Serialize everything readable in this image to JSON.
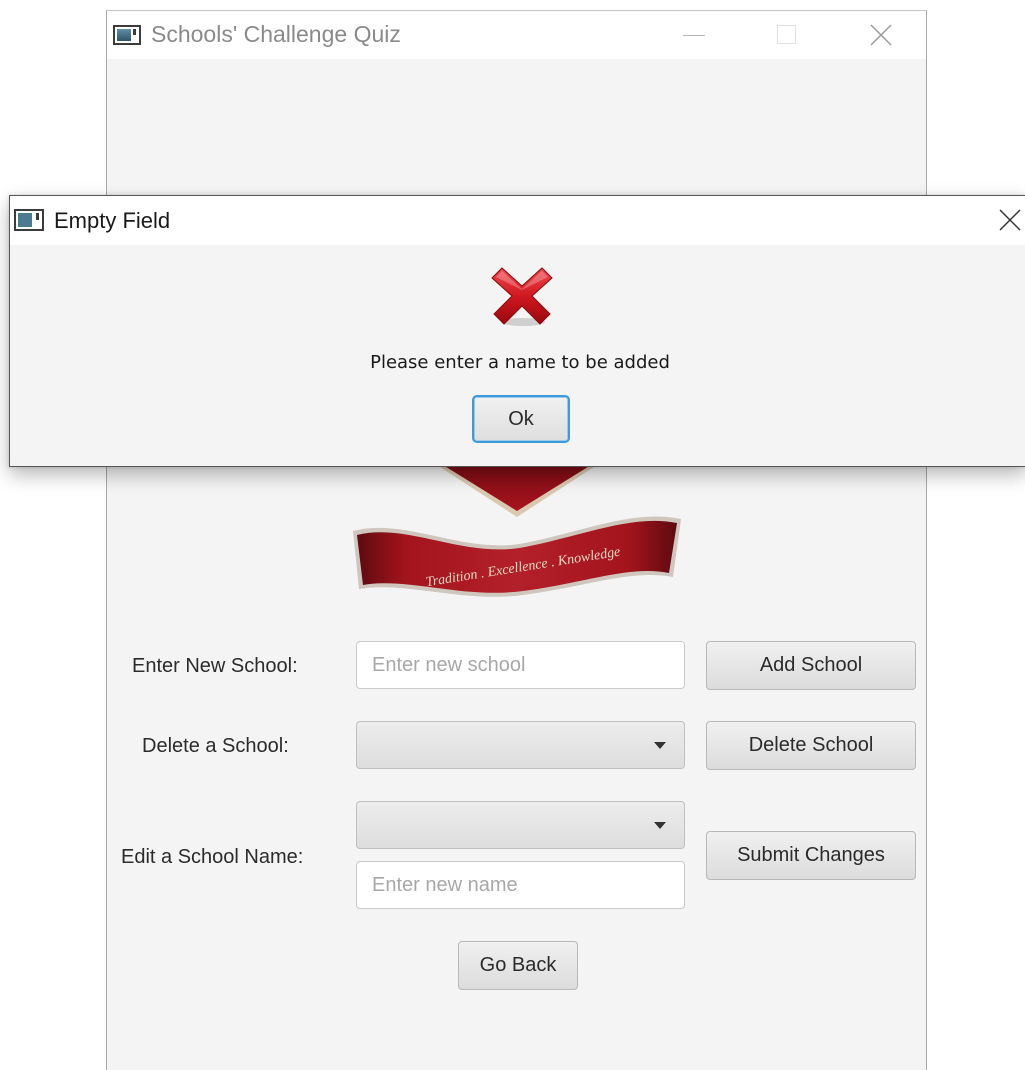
{
  "main_window": {
    "title": "Schools' Challenge Quiz",
    "logo_motto": "Tradition . Excellence . Knowledge",
    "form": {
      "new_school_label": "Enter New School:",
      "new_school_value": "",
      "new_school_placeholder": "Enter new school",
      "add_button": "Add School",
      "delete_label": "Delete a School:",
      "delete_selected": "",
      "delete_button": "Delete School",
      "edit_label": "Edit a School Name:",
      "edit_selected": "",
      "edit_name_value": "",
      "edit_name_placeholder": "Enter new name",
      "submit_button": "Submit Changes",
      "back_button": "Go Back"
    }
  },
  "dialog": {
    "title": "Empty Field",
    "message": "Please enter a name to be added",
    "ok_button": "Ok",
    "icon": "error-x-icon"
  },
  "colors": {
    "error_red": "#c8151b",
    "focus_blue": "#3c9ad8",
    "window_bg": "#f4f4f4"
  }
}
